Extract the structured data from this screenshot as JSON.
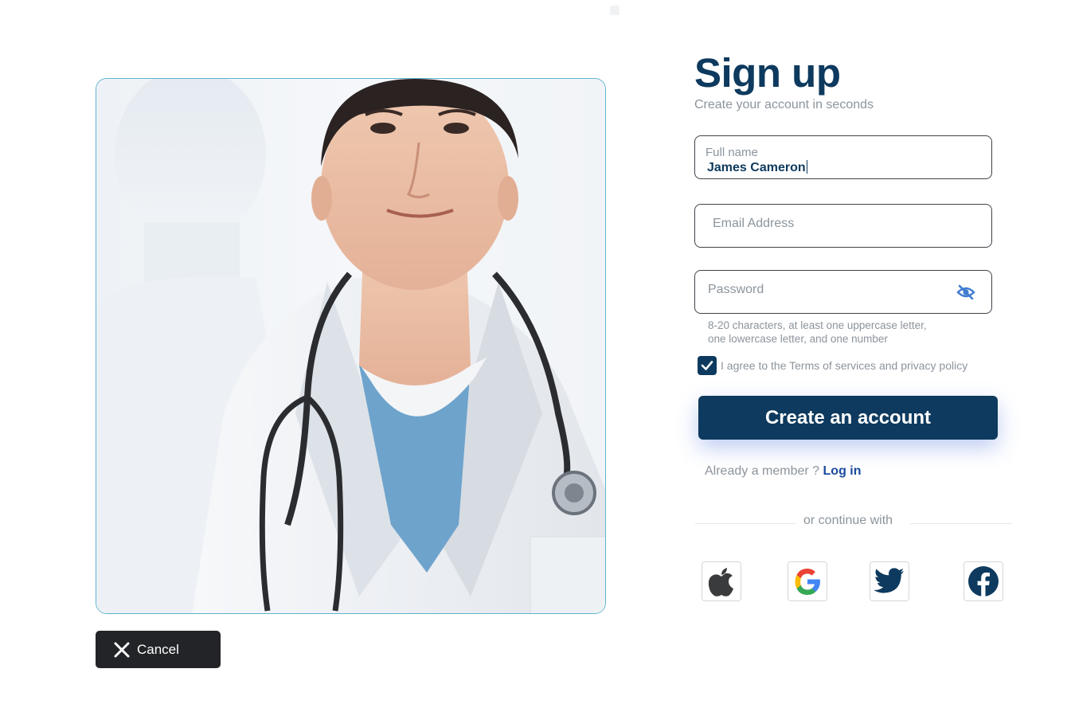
{
  "hero": {
    "image_alt": "doctor-with-stethoscope-illustration",
    "carousel": {
      "slides": 2,
      "active": 1
    }
  },
  "cancel": {
    "label": "Cancel",
    "icon": "close-icon"
  },
  "form": {
    "title": "Sign up",
    "subtitle": "Create your account in seconds",
    "full_name": {
      "label": "Full name",
      "value": "James Cameron"
    },
    "email": {
      "placeholder": "Email Address",
      "value": ""
    },
    "password": {
      "placeholder": "Password",
      "value": "",
      "toggle_icon": "eye-off-icon"
    },
    "password_hint": {
      "line1": "8-20 characters, at least one uppercase letter,",
      "line2": "one lowercase letter, and one number"
    },
    "agree": {
      "checked": true,
      "label": "I agree to the Terms of services and privacy policy"
    },
    "submit_label": "Create an account",
    "member_text": "Already a member ?",
    "login_label": "Log in",
    "divider_text": "or continue with",
    "social": [
      {
        "name": "Apple",
        "icon": "apple-icon"
      },
      {
        "name": "Google",
        "icon": "google-icon"
      },
      {
        "name": "Twitter",
        "icon": "twitter-icon"
      },
      {
        "name": "Facebook",
        "icon": "facebook-icon"
      }
    ]
  },
  "colors": {
    "primary": "#0d3a5e",
    "muted_text": "#8c949c",
    "link": "#1a4aa0",
    "cancel_bg": "#232427",
    "hero_border": "#5fb3cf"
  }
}
